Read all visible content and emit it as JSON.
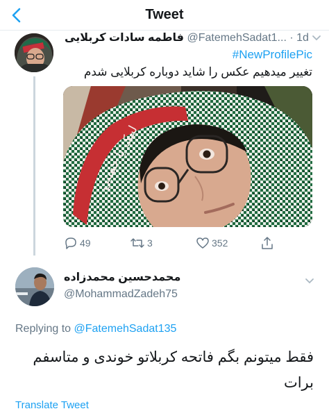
{
  "header": {
    "title": "Tweet"
  },
  "tweet": {
    "author_name": "فاطمه سادات کربلایی",
    "author_handle": "@FatemehSadat1...",
    "time": "1d",
    "hashtag": "#NewProfilePic",
    "text": "تغییر میدهیم عکس را شاید دوباره کربلایی شدم",
    "stats": {
      "replies": "49",
      "retweets": "3",
      "likes": "352"
    }
  },
  "reply": {
    "author_name": "محمدحسین محمدزاده",
    "author_handle": "@MohammadZadeh75",
    "replying_prefix": "Replying to",
    "replying_handle": "@FatemehSadat135",
    "text": "فقط میتونم بگم فاتحه کربلاتو خوندی و متاسفم برات",
    "translate_label": "Translate Tweet"
  },
  "colors": {
    "accent": "#1da1f2",
    "secondary": "#657786",
    "divider": "#e6ecf0"
  }
}
